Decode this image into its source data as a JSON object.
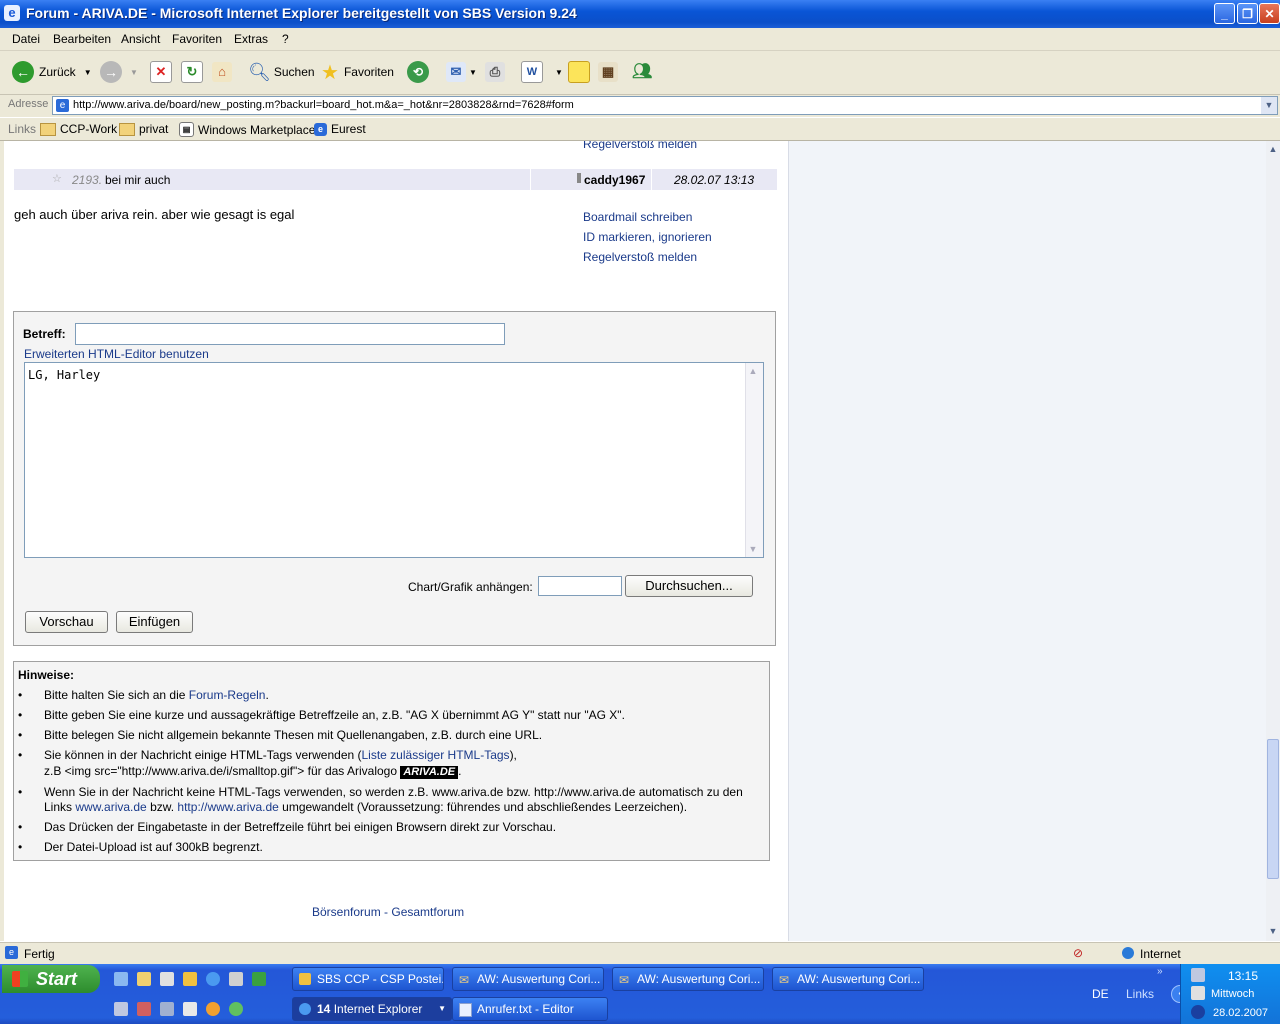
{
  "window": {
    "title": "Forum - ARIVA.DE - Microsoft Internet Explorer bereitgestellt von SBS Version 9.24"
  },
  "menu": [
    "Datei",
    "Bearbeiten",
    "Ansicht",
    "Favoriten",
    "Extras",
    "?"
  ],
  "toolbar": {
    "back": "Zurück",
    "search": "Suchen",
    "favorites": "Favoriten"
  },
  "address": {
    "label": "Adresse",
    "url": "http://www.ariva.de/board/new_posting.m?backurl=board_hot.m&a=_hot&nr=2803828&rnd=7628#form"
  },
  "links": {
    "label": "Links",
    "items": [
      "CCP-Work",
      "privat",
      "Windows Marketplace",
      "Eurest"
    ]
  },
  "post": {
    "partial_action": "Regelverstoß melden",
    "number": "2193.",
    "subject": "bei mir auch",
    "author": "caddy1967",
    "date": "28.02.07 13:13",
    "body": "geh auch über ariva rein. aber wie gesagt is egal",
    "actions": [
      "Boardmail schreiben",
      "ID markieren, ignorieren",
      "Regelverstoß melden"
    ]
  },
  "form": {
    "subject_label": "Betreff:",
    "subject_value": "",
    "editor_link": "Erweiterten HTML-Editor benutzen",
    "message_value": "LG, Harley",
    "attach_label": "Chart/Grafik anhängen:",
    "browse_button": "Durchsuchen...",
    "preview_button": "Vorschau",
    "submit_button": "Einfügen"
  },
  "hints": {
    "title": "Hinweise:",
    "h1_pre": "Bitte halten Sie sich an die ",
    "h1_link": "Forum-Regeln",
    "h1_post": ".",
    "h2": "Bitte geben Sie eine kurze und aussagekräftige Betreffzeile an, z.B. \"AG X übernimmt AG Y\" statt nur \"AG X\".",
    "h3": "Bitte belegen Sie nicht allgemein bekannte Thesen mit Quellenangaben, z.B. durch eine URL.",
    "h4_pre": "Sie können in der Nachricht einige HTML-Tags verwenden (",
    "h4_link": "Liste zulässiger HTML-Tags",
    "h4_post": "),",
    "h4_line2": "z.B <img src=\"http://www.ariva.de/i/smalltop.gif\"> für das Arivalogo",
    "logo_text": "ARIVA.DE",
    "h4_end": ".",
    "h5_line1": "Wenn Sie in der Nachricht keine HTML-Tags verwenden, so werden z.B. www.ariva.de bzw. http://www.ariva.de automatisch zu den",
    "h5_pre": "Links ",
    "h5_link1": "www.ariva.de",
    "h5_mid": " bzw. ",
    "h5_link2": "http://www.ariva.de",
    "h5_post": " umgewandelt (Voraussetzung: führendes und abschließendes Leerzeichen).",
    "h6": "Das Drücken der Eingabetaste in der Betreffzeile führt bei einigen Browsern direkt zur Vorschau.",
    "h7": "Der Datei-Upload ist auf 300kB begrenzt."
  },
  "footer": {
    "link1": "Börsenforum",
    "sep": " - ",
    "link2": "Gesamtforum"
  },
  "status": {
    "text": "Fertig",
    "zone": "Internet"
  },
  "taskbar": {
    "start": "Start",
    "tasks_row1": [
      "SBS CCP - CSP Postei...",
      "AW: Auswertung Cori...",
      "AW: Auswertung Cori...",
      "AW: Auswertung Cori..."
    ],
    "ie_group_count": "14",
    "ie_group_label": "Internet Explorer",
    "editor_task": "Anrufer.txt - Editor",
    "lang": "DE",
    "links": "Links",
    "time": "13:15",
    "weekday": "Mittwoch",
    "date": "28.02.2007"
  },
  "colors": {
    "link": "#1a3a8a",
    "post_header_bg": "#e8e8f4",
    "xp_blue": "#245edb"
  }
}
